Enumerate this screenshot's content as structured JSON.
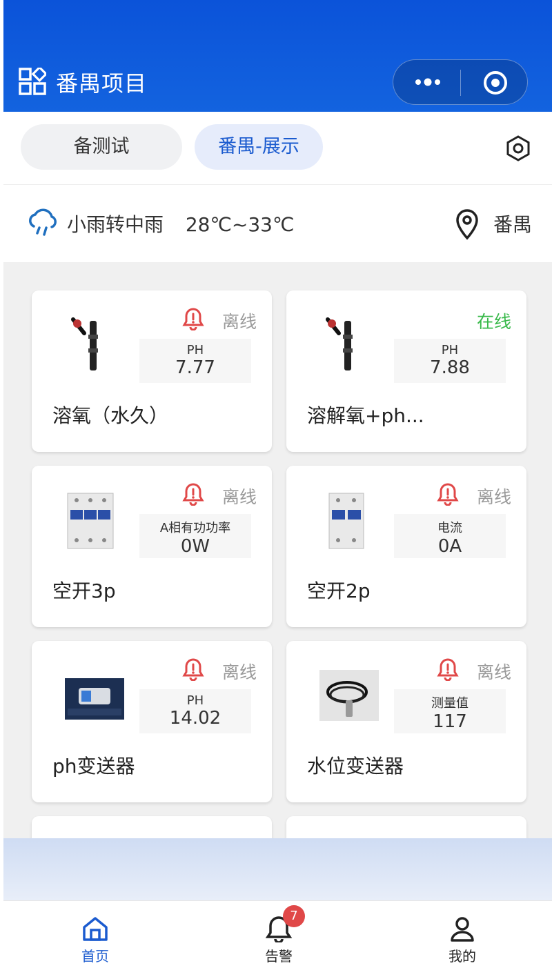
{
  "header": {
    "title": "番禺项目",
    "brand_color": "#0b53d9"
  },
  "tabs": [
    {
      "label": "备测试",
      "active": false
    },
    {
      "label": "番禺-展示",
      "active": true
    }
  ],
  "weather": {
    "description": "小雨转中雨",
    "temperature": "28℃~33℃",
    "location": "番禺"
  },
  "devices": [
    {
      "name": "溶氧（水久）",
      "status": "离线",
      "alarm": true,
      "metric_label": "PH",
      "metric_value": "7.77",
      "image": "probe-sensor"
    },
    {
      "name": "溶解氧+ph...",
      "status": "在线",
      "alarm": false,
      "metric_label": "PH",
      "metric_value": "7.88",
      "image": "probe-sensor"
    },
    {
      "name": "空开3p",
      "status": "离线",
      "alarm": true,
      "metric_label": "A相有功功率",
      "metric_value": "0W",
      "image": "breaker-3p"
    },
    {
      "name": "空开2p",
      "status": "离线",
      "alarm": true,
      "metric_label": "电流",
      "metric_value": "0A",
      "image": "breaker-2p"
    },
    {
      "name": "ph变送器",
      "status": "离线",
      "alarm": true,
      "metric_label": "PH",
      "metric_value": "14.02",
      "image": "ph-transmitter"
    },
    {
      "name": "水位变送器",
      "status": "离线",
      "alarm": true,
      "metric_label": "测量值",
      "metric_value": "117",
      "image": "level-cable"
    }
  ],
  "bottom_nav": [
    {
      "label": "首页",
      "icon": "home-icon",
      "active": true
    },
    {
      "label": "告警",
      "icon": "bell-icon",
      "badge": "7"
    },
    {
      "label": "我的",
      "icon": "user-icon"
    }
  ],
  "colors": {
    "online": "#38b94a",
    "offline": "#9a9a9a",
    "alarm": "#e04848",
    "accent": "#1b5bcf"
  }
}
